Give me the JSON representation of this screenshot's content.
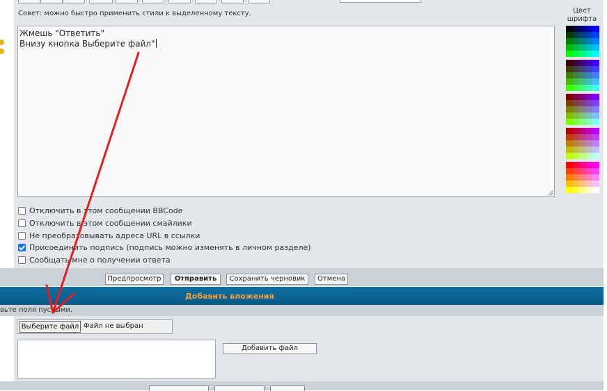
{
  "editor": {
    "hint": "Совет: можно быстро применить стили к выделенному тексту.",
    "line1": "Жмешь \"Ответить\"",
    "line2": "Внизу кнопка Выберите файл\""
  },
  "color_panel": {
    "label_line1": "Цвет",
    "label_line2": "шрифта",
    "swatches": [
      [
        "#000000",
        "#000040",
        "#000080",
        "#0000bf",
        "#0000ff"
      ],
      [
        "#004000",
        "#004040",
        "#004080",
        "#0040bf",
        "#0040ff"
      ],
      [
        "#008000",
        "#008040",
        "#008080",
        "#0080bf",
        "#0080ff"
      ],
      [
        "#00bf00",
        "#00bf40",
        "#00bf80",
        "#00bfbf",
        "#00bfff"
      ],
      [
        "#00ff00",
        "#00ff40",
        "#00ff80",
        "#00ffbf",
        "#00ffff"
      ],
      [
        "#400000",
        "#400040",
        "#400080",
        "#4000bf",
        "#4000ff"
      ],
      [
        "#404000",
        "#404040",
        "#404080",
        "#4040bf",
        "#4040ff"
      ],
      [
        "#408000",
        "#408040",
        "#408080",
        "#4080bf",
        "#4080ff"
      ],
      [
        "#40bf00",
        "#40bf40",
        "#40bf80",
        "#40bfbf",
        "#40bfff"
      ],
      [
        "#40ff00",
        "#40ff40",
        "#40ff80",
        "#40ffbf",
        "#40ffff"
      ],
      [
        "#800000",
        "#800040",
        "#800080",
        "#8000bf",
        "#8000ff"
      ],
      [
        "#804000",
        "#804040",
        "#804080",
        "#8040bf",
        "#8040ff"
      ],
      [
        "#808000",
        "#808040",
        "#808080",
        "#8080bf",
        "#8080ff"
      ],
      [
        "#80bf00",
        "#80bf40",
        "#80bf80",
        "#80bfbf",
        "#80bfff"
      ],
      [
        "#80ff00",
        "#80ff40",
        "#80ff80",
        "#80ffbf",
        "#80ffff"
      ],
      [
        "#bf0000",
        "#bf0040",
        "#bf0080",
        "#bf00bf",
        "#bf00ff"
      ],
      [
        "#bf4000",
        "#bf4040",
        "#bf4080",
        "#bf40bf",
        "#bf40ff"
      ],
      [
        "#bf8000",
        "#bf8040",
        "#bf8080",
        "#bf80bf",
        "#bf80ff"
      ],
      [
        "#bfbf00",
        "#bfbf40",
        "#bfbf80",
        "#bfbfbf",
        "#bfbfff"
      ],
      [
        "#bfff00",
        "#bfff40",
        "#bfff80",
        "#bfffbf",
        "#bfffff"
      ],
      [
        "#ff0000",
        "#ff0040",
        "#ff0080",
        "#ff00bf",
        "#ff00ff"
      ],
      [
        "#ff4000",
        "#ff4040",
        "#ff4080",
        "#ff40bf",
        "#ff40ff"
      ],
      [
        "#ff8000",
        "#ff8040",
        "#ff8080",
        "#ff80bf",
        "#ff80ff"
      ],
      [
        "#ffbf00",
        "#ffbf40",
        "#ffbf80",
        "#ffbfbf",
        "#ffbfff"
      ],
      [
        "#ffff00",
        "#ffff40",
        "#ffff80",
        "#ffffbf",
        "#ffffff"
      ]
    ]
  },
  "options": {
    "disable_bbcode": "Отключить в этом сообщении BBCode",
    "disable_smilies": "Отключить в этом сообщении смайлики",
    "no_url_parse": "Не преобразовывать адреса URL в ссылки",
    "attach_sig": "Присоединить подпись (подпись можно изменять в личном разделе)",
    "notify": "Сообщать мне о получении ответа",
    "attach_sig_checked": true
  },
  "buttons": {
    "preview": "Предпросмотр",
    "submit": "Отправить",
    "save_draft": "Сохранить черновик",
    "cancel": "Отмена"
  },
  "attachments": {
    "header": "Добавить вложения",
    "note": "вьте поля пустыми.",
    "choose_file": "Выберите файл",
    "no_file": "Файл не выбран",
    "add_file": "Добавить файл"
  },
  "colors": {
    "accent_header": "#0a5a87",
    "header_text": "#f0a040",
    "arrow": "#e02020"
  }
}
